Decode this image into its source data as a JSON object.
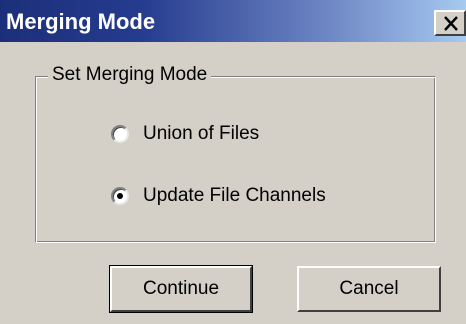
{
  "window": {
    "title": "Merging Mode",
    "close_glyph": "X",
    "close_icon": "close-icon",
    "title_gradient": [
      "#1c2f7a",
      "#a6caf0"
    ]
  },
  "group": {
    "label": "Set Merging Mode",
    "options": [
      {
        "label": "Union of Files",
        "selected": false
      },
      {
        "label": "Update File Channels",
        "selected": true
      }
    ]
  },
  "buttons": {
    "continue_label": "Continue",
    "cancel_label": "Cancel"
  }
}
